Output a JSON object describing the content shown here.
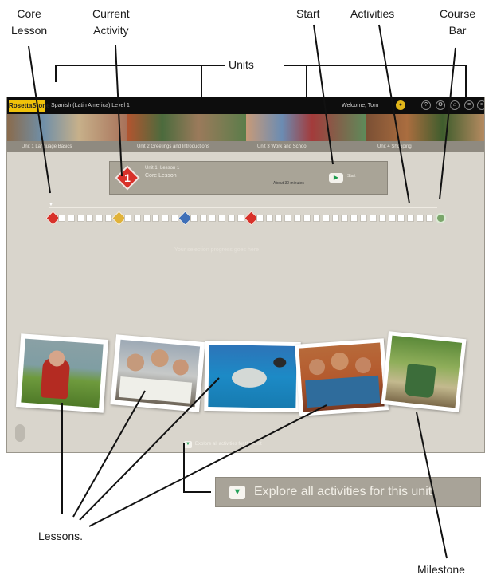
{
  "callouts": {
    "core_lesson": [
      "Core",
      "Lesson"
    ],
    "current_activity": [
      "Current",
      "Activity"
    ],
    "start": "Start",
    "activities": "Activities",
    "course_bar": [
      "Course",
      "Bar"
    ],
    "units": "Units",
    "lessons": "Lessons.",
    "milestone": "Milestone"
  },
  "app": {
    "logo": "RosettaStone",
    "course_title": "Spanish (Latin America) Level 1",
    "welcome": "Welcome, Tom",
    "units": [
      {
        "label": "Unit 1 Language Basics"
      },
      {
        "label": "Unit 2 Greetings and Introductions"
      },
      {
        "label": "Unit 3 Work and School"
      },
      {
        "label": "Unit 4 Shopping"
      }
    ]
  },
  "current_activity": {
    "number": "1",
    "subtitle": "Unit 1, Lesson 1",
    "name": "Core Lesson",
    "duration": "About 30 minutes",
    "start_label": "Start"
  },
  "explore": {
    "label": "Explore all activities for this unit"
  },
  "colors": {
    "accent_yellow": "#f0c20a",
    "core_red": "#d8312a",
    "lesson2_gold": "#e0b23a",
    "lesson3_blue": "#3e6fb8",
    "milestone_green": "#7aa66a",
    "start_green": "#1a9a4a"
  }
}
